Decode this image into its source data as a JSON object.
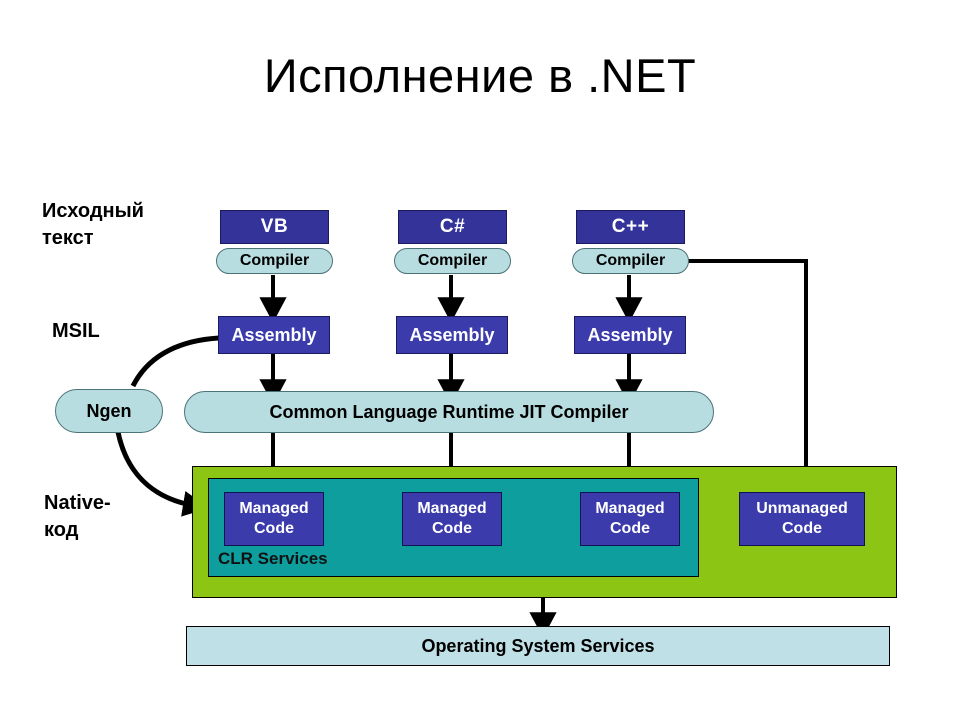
{
  "slide": {
    "title": "Исполнение в .NET"
  },
  "stage_labels": [
    {
      "id": "source",
      "text": "Исходный\nтекст"
    },
    {
      "id": "msil",
      "text": "MSIL"
    },
    {
      "id": "native",
      "text": "Native-\nкод"
    }
  ],
  "languages": [
    {
      "name": "VB",
      "compiler": "Compiler",
      "assembly": "Assembly"
    },
    {
      "name": "C#",
      "compiler": "Compiler",
      "assembly": "Assembly"
    },
    {
      "name": "C++",
      "compiler": "Compiler",
      "assembly": "Assembly"
    }
  ],
  "ngen": {
    "label": "Ngen"
  },
  "jit": {
    "label": "Common Language Runtime JIT Compiler"
  },
  "runtime": {
    "clr_services_label": "CLR Services",
    "managed_code": [
      {
        "line1": "Managed",
        "line2": "Code"
      },
      {
        "line1": "Managed",
        "line2": "Code"
      },
      {
        "line1": "Managed",
        "line2": "Code"
      }
    ],
    "unmanaged_code": {
      "line1": "Unmanaged",
      "line2": "Code"
    }
  },
  "os": {
    "label": "Operating System Services"
  },
  "colors": {
    "language_box": "#333399",
    "assembly_box": "#3b3bac",
    "pill": "#b8dde0",
    "green_panel": "#8CC513",
    "teal_panel": "#0E9E9E",
    "code_box": "#3b3bac",
    "os_bar": "#bfe0e6",
    "arrow": "#000000",
    "text_light": "#ffffff",
    "text_dark": "#000000"
  }
}
